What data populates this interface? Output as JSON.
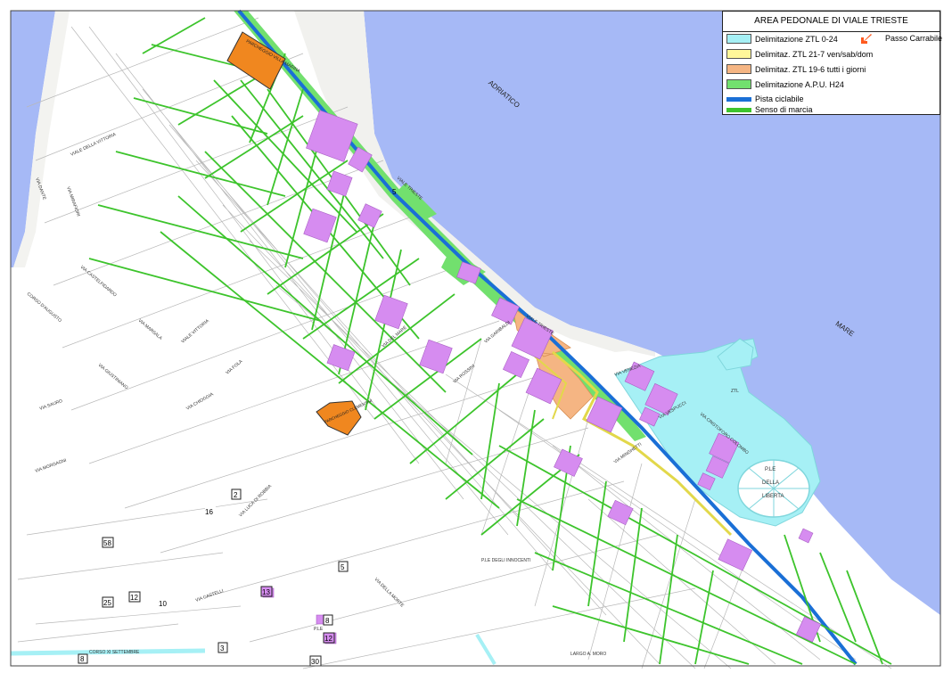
{
  "legend": {
    "title": "AREA PEDONALE DI VIALE TRIESTE",
    "items": [
      {
        "label": "Delimitazione ZTL 0-24",
        "color": "#a6f0f5"
      },
      {
        "label": "Delimitaz. ZTL 21-7 ven/sab/dom",
        "color": "#fff79a"
      },
      {
        "label": "Delimitaz. ZTL 19-6 tutti i giorni",
        "color": "#f5b583"
      },
      {
        "label": "Delimitazione A.P.U. H24",
        "color": "#72e06e"
      },
      {
        "label": "Pista ciclabile",
        "color": "#1a6fd6"
      },
      {
        "label": "Senso di marcia",
        "color": "#3dc42c"
      }
    ],
    "passo_label": "Passo Carrabile",
    "passo_color": "#ff5a1f"
  },
  "sea_labels": [
    "ADRIATICO",
    "MARE"
  ],
  "parking": [
    {
      "label": "PARCHEGGIO VILLA MARINA"
    },
    {
      "label": "PARCHEGGIO CLEMENTINI"
    }
  ],
  "piazza": {
    "line1": "P.LE",
    "line2": "DELLA",
    "line3": "LIBERTA"
  },
  "street_labels": [
    "VIALE TRIESTE",
    "VIALE TRIESTE",
    "VIA VENEZIA",
    "VIA VESPUCCI",
    "VIA CRISTOFORO COLOMBO",
    "VIA MIRAFIORI",
    "CORSO D'AUGUSTO",
    "VIA LUCA DI ROBBIA",
    "VIA CASTELFIDARDO",
    "VIA DANTE",
    "VIA SAURO",
    "VIA MARSALA",
    "VIALE VITTORIA",
    "VIA CHIOGGIA",
    "VIALE DELLA VITTORIA",
    "VIA GIUSTINIANO",
    "VIA MORGAGNI",
    "VIA FOLA",
    "VIA CASTELLI",
    "VIA DEL MARE",
    "CORSO XI SETTEMBRE",
    "P.LE DEGLI INNOCENTI",
    "LARGO A. MORO",
    "VIA ROSSINI",
    "VIA DELLA MORTE",
    "VIA GARIBALDI",
    "VIA MINGHETTI"
  ],
  "numbers": [
    "2",
    "16",
    "58",
    "25",
    "12",
    "10",
    "13",
    "5",
    "8",
    "12",
    "3",
    "30",
    "8",
    "5"
  ],
  "ztl_label": "ZTL",
  "pla_label": "P.LE"
}
